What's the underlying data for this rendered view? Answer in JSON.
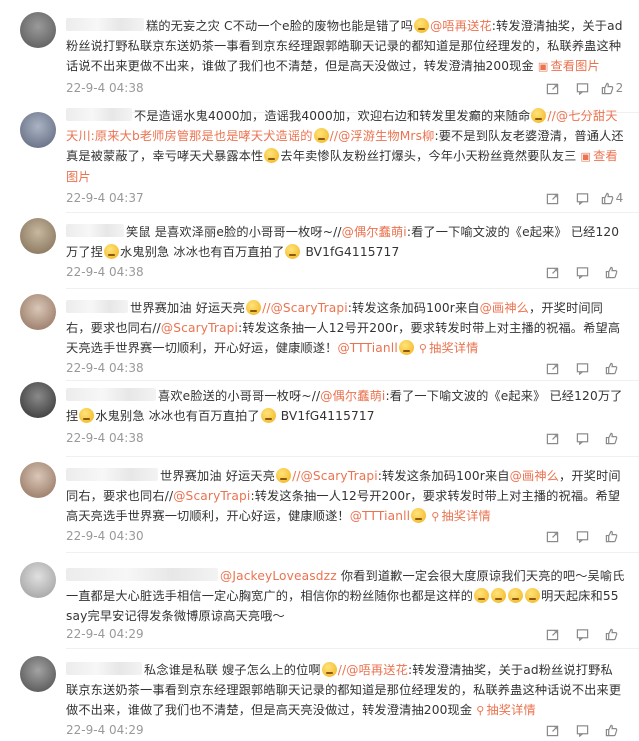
{
  "comments": [
    {
      "pre": "糕的无妄之灾 C不动一个e脸的废物也能是错了吗",
      "mention": "@唔再送花",
      "post": ":转发澄清抽奖，关于ad粉丝说打野私联京东送奶茶一事看到京东经理跟郭皓聊天记录的都知道是那位经理发的，私联养蛊这种话说不出来更做不出来，谁做了我们也不清楚，但是高天没做过，转发澄清抽200现金",
      "pic": "查看图片",
      "time": "22-9-4 04:38",
      "likes": "2"
    },
    {
      "pre": "不是造谣水鬼4000加，造谣我4000加，欢迎右边和转发里发癫的来随命",
      "mention": "//@七分甜天天",
      "mid": "川:原来大b老师房管那是也是哮天犬造谣的",
      "mention2": "//@浮游生物Mrs柳",
      "post": ":要不是到队友老婆澄清，普通人还真是被蒙蔽了，幸亏哮天犬暴露本性",
      "post2": "去年卖惨队友粉丝打爆头，今年小天粉丝竟然要队友三",
      "pic": "查看图片",
      "time": "22-9-4 04:37",
      "likes": "4"
    },
    {
      "pre": "笑鼠 是喜欢泽丽e脸的小哥哥一枚呀~//",
      "mention": "@偶尔蠢萌i",
      "post": ":看了一下喻文波的《e起来》 已经120万了捏",
      "post2": "水鬼别急 冰冰也有百万直拍了",
      "post3": "BV1fG4115717",
      "time": "22-9-4 04:38",
      "likes": ""
    },
    {
      "pre": "世界赛加油 好运天亮",
      "mention": "//@ScaryTrapi",
      "post": ":转发这条加码100r来自",
      "mention2": "@画神么",
      "post2": "，开奖时间同右，要求也同右//",
      "mention3": "@ScaryTrapi",
      "post3": ":转发这条抽一人12号开200r，要求转发时带上对主播的祝福。希望高天亮选手世界赛一切顺利，开心好运，健康顺遂！",
      "mention4": "@TTTianll",
      "lottery": "抽奖详情",
      "time": "22-9-4 04:38",
      "likes": ""
    },
    {
      "pre": "喜欢e脸送的小哥哥一枚呀~//",
      "mention": "@偶尔蠢萌i",
      "post": ":看了一下喻文波的《e起来》 已经120万了捏",
      "post2": "水鬼别急 冰冰也有百万直拍了",
      "post3": "BV1fG4115717",
      "time": "22-9-4 04:38",
      "likes": ""
    },
    {
      "pre": "世界赛加油 好运天亮",
      "mention": "//@ScaryTrapi",
      "post": ":转发这条加码100r来自",
      "mention2": "@画神么",
      "post2": "，开奖时间同右，要求也同右//",
      "mention3": "@ScaryTrapi",
      "post3": ":转发这条抽一人12号开200r，要求转发时带上对主播的祝福。希望高天亮选手世界赛一切顺利，开心好运，健康顺遂！",
      "mention4": "@TTTianll",
      "lottery": "抽奖详情",
      "time": "22-9-4 04:30",
      "likes": ""
    },
    {
      "mention": "@JackeyLoveasdzz",
      "post": "你看到道歉一定会很大度原谅我们天亮的吧～吴喻氏一直都是大心脏选手相信一定心胸宽广的，相信你的粉丝随你也都是这样的",
      "post2": "明天起床和55say完早安记得发条微博原谅高天亮哦～",
      "time": "22-9-4 04:29",
      "likes": ""
    },
    {
      "pre": "私念谁是私联 嫂子怎么上的位啊",
      "mention": "//@唔再送花",
      "post": ":转发澄清抽奖，关于ad粉丝说打野私联京东送奶茶一事看到京东经理跟郭皓聊天记录的都知道是那位经理发的，私联养蛊这种话说不出来更做不出来，谁做了我们也不清楚，但是高天亮没做过，转发澄清抽200现金",
      "lottery": "抽奖详情",
      "time": "22-9-4 04:29",
      "likes": ""
    }
  ],
  "colors": {
    "link": "#eb7350",
    "meta": "#999999"
  },
  "icons": [
    "share-icon",
    "comment-icon",
    "like-icon",
    "picture-icon",
    "lottery-icon"
  ]
}
